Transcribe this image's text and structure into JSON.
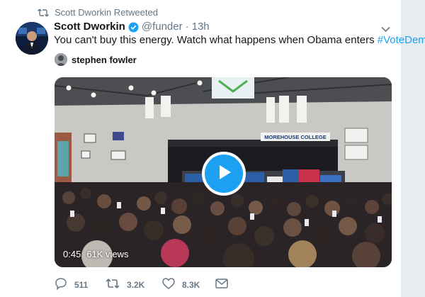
{
  "retweet_banner": {
    "text": "Scott Dworkin Retweeted"
  },
  "tweet": {
    "author_name": "Scott Dworkin",
    "handle": "@funder",
    "separator": "·",
    "time": "13h",
    "text": "You can't buy this energy. Watch what happens when Obama enters ",
    "hashtag": "#VoteDem",
    "attribution": "stephen fowler"
  },
  "video": {
    "duration": "0:45",
    "views": "61K views",
    "banner_text": "MOREHOUSE COLLEGE"
  },
  "actions": {
    "replies": "511",
    "retweets": "3.2K",
    "likes": "8.3K"
  },
  "colors": {
    "accent": "#1da1f2",
    "muted": "#657786",
    "text": "#14171a",
    "background": "#e6ecf0"
  },
  "icons": {
    "retweet_banner": "retweet-icon",
    "verified": "verified-badge-icon",
    "caret": "chevron-down-icon",
    "play": "play-icon",
    "reply": "reply-icon",
    "retweet": "retweet-icon",
    "like": "heart-icon",
    "dm": "envelope-icon"
  }
}
